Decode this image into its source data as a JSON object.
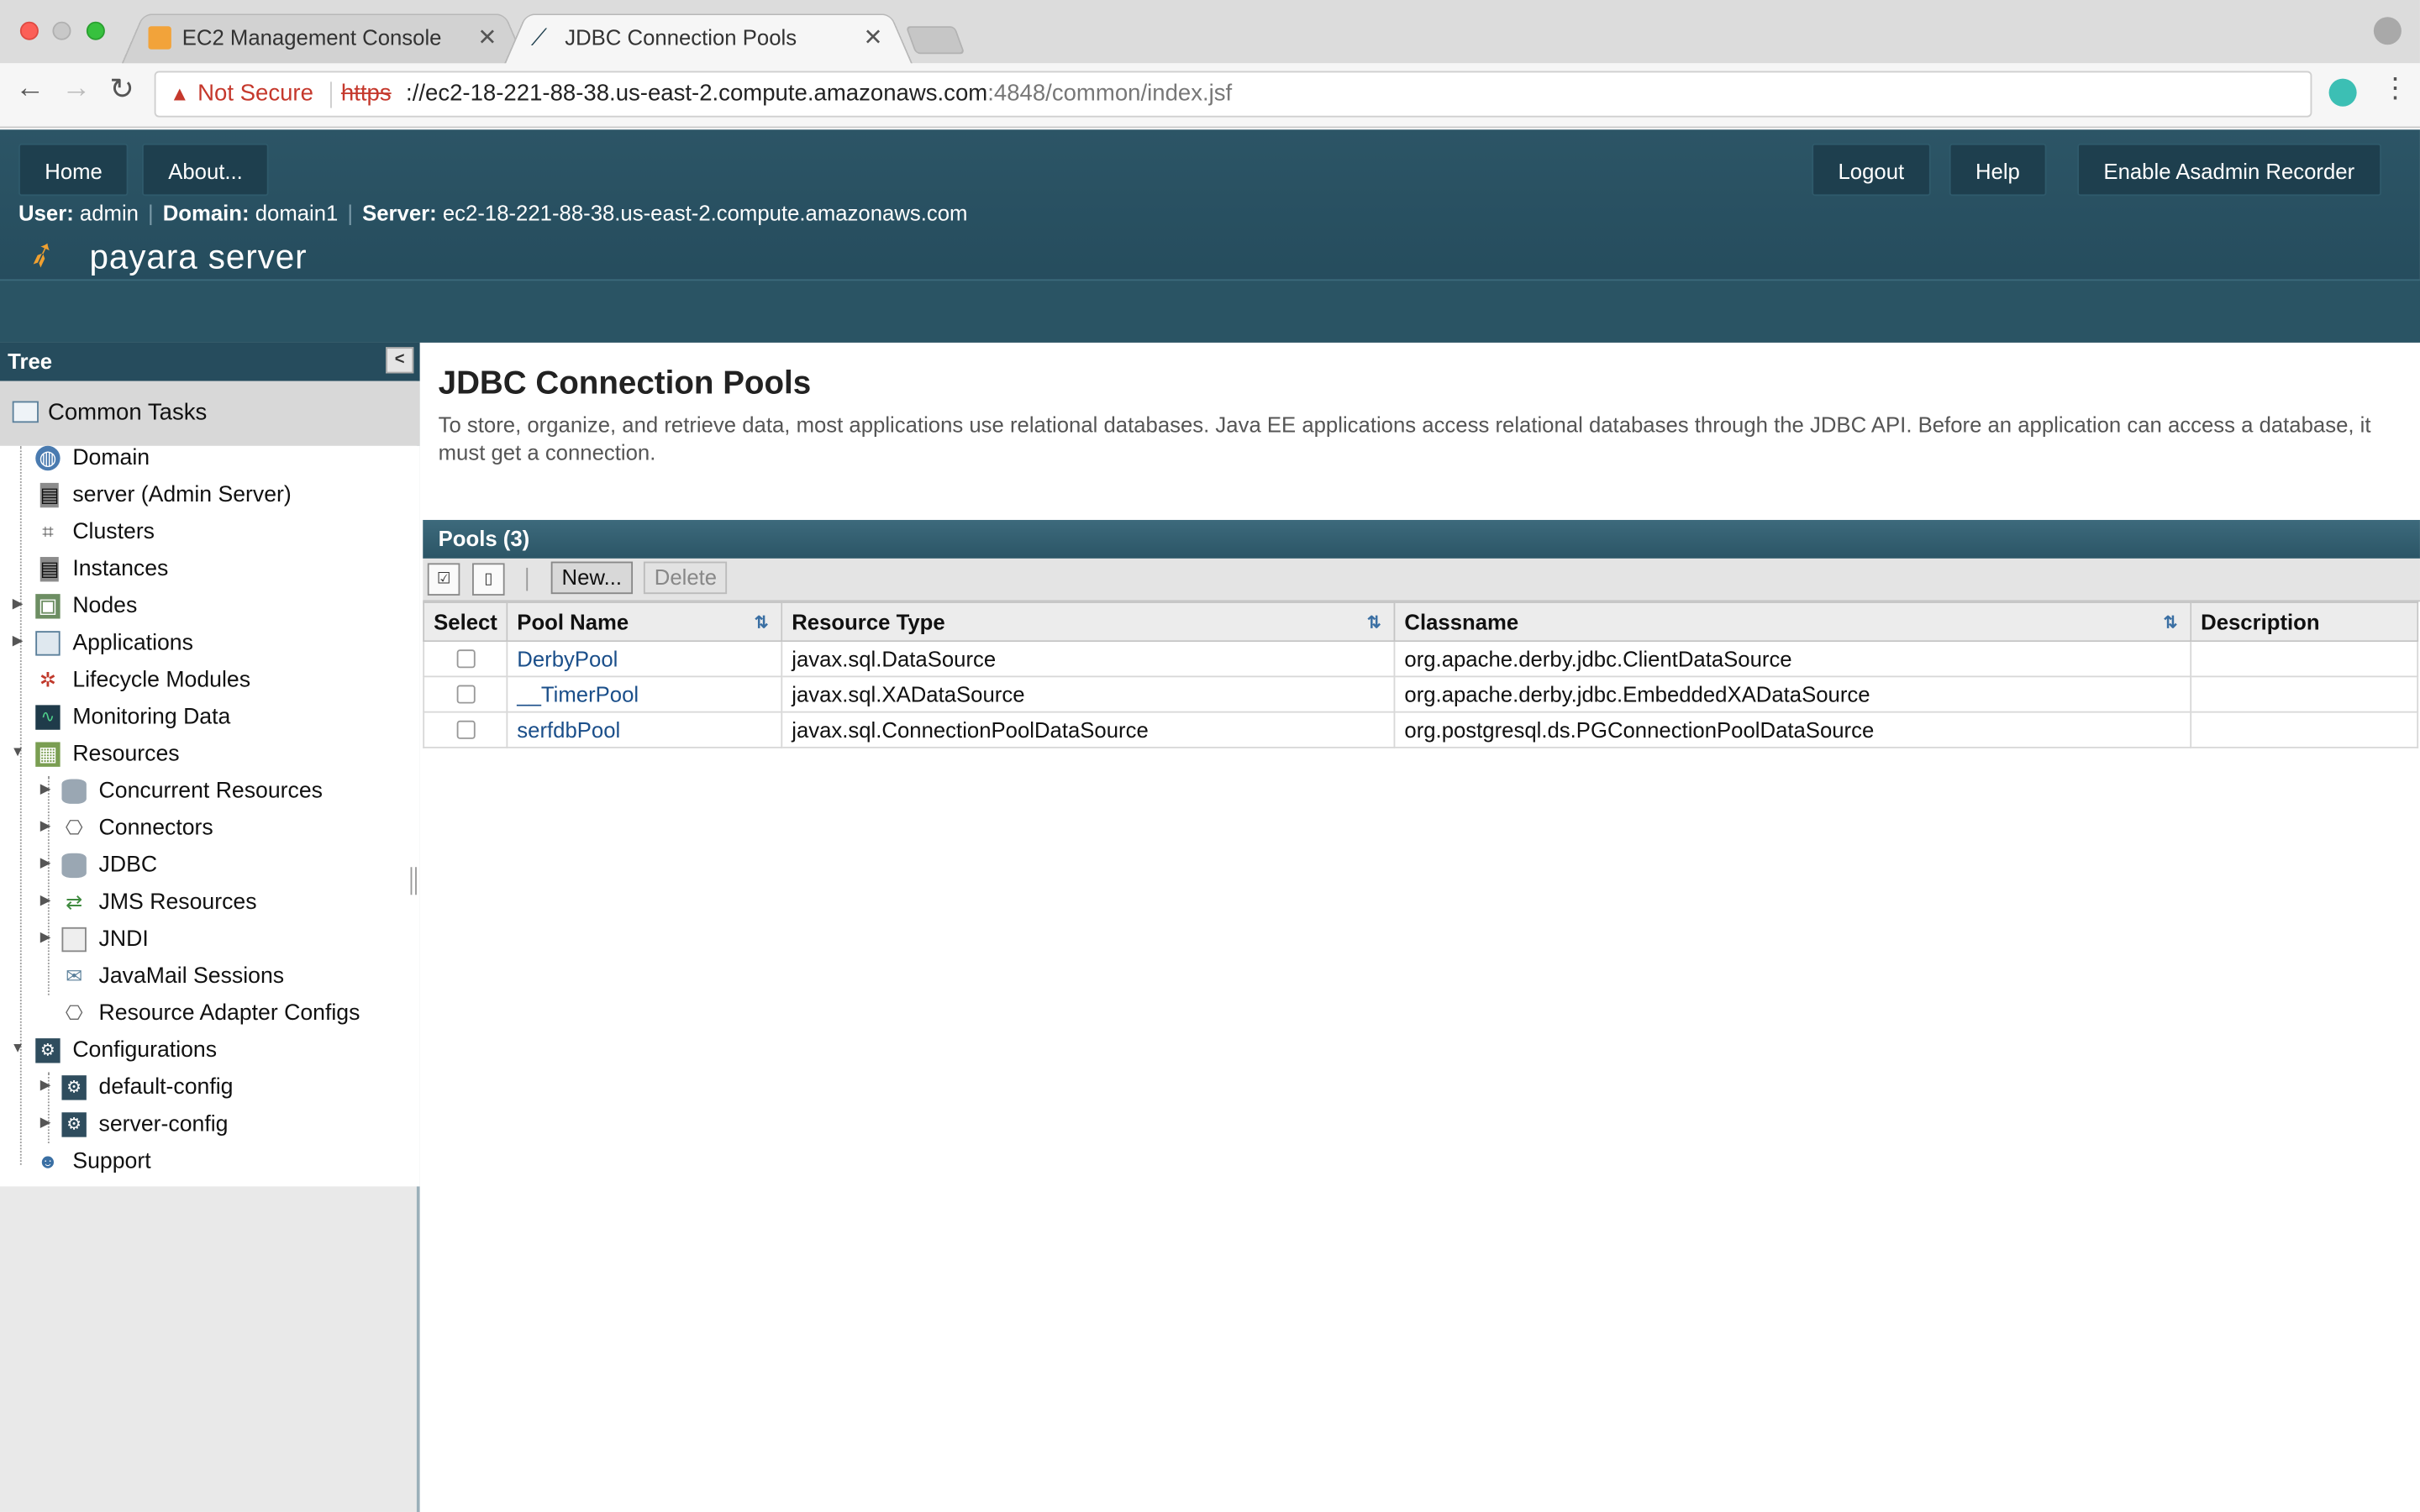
{
  "browser": {
    "tabs": [
      {
        "title": "EC2 Management Console"
      },
      {
        "title": "JDBC Connection Pools"
      }
    ],
    "security_label": "Not Secure",
    "url_scheme": "https",
    "url_host": "://ec2-18-221-88-38.us-east-2.compute.amazonaws.com",
    "url_rest": ":4848/common/index.jsf"
  },
  "header": {
    "home": "Home",
    "about": "About...",
    "logout": "Logout",
    "help": "Help",
    "recorder": "Enable Asadmin Recorder",
    "user_label": "User:",
    "user": "admin",
    "domain_label": "Domain:",
    "domain": "domain1",
    "server_label": "Server:",
    "server": "ec2-18-221-88-38.us-east-2.compute.amazonaws.com",
    "logo": "payara server"
  },
  "tree": {
    "title": "Tree",
    "common_tasks": "Common Tasks",
    "items": [
      {
        "label": "Domain"
      },
      {
        "label": "server (Admin Server)"
      },
      {
        "label": "Clusters"
      },
      {
        "label": "Instances"
      },
      {
        "label": "Nodes"
      },
      {
        "label": "Applications"
      },
      {
        "label": "Lifecycle Modules"
      },
      {
        "label": "Monitoring Data"
      },
      {
        "label": "Resources"
      },
      {
        "label": "Concurrent Resources"
      },
      {
        "label": "Connectors"
      },
      {
        "label": "JDBC"
      },
      {
        "label": "JMS Resources"
      },
      {
        "label": "JNDI"
      },
      {
        "label": "JavaMail Sessions"
      },
      {
        "label": "Resource Adapter Configs"
      },
      {
        "label": "Configurations"
      },
      {
        "label": "default-config"
      },
      {
        "label": "server-config"
      },
      {
        "label": "Support"
      }
    ]
  },
  "main": {
    "title": "JDBC Connection Pools",
    "description": "To store, organize, and retrieve data, most applications use relational databases. Java EE applications access relational databases through the JDBC API. Before an application can access a database, it must get a connection.",
    "pools_header": "Pools (3)",
    "new_button": "New...",
    "delete_button": "Delete",
    "columns": [
      "Select",
      "Pool Name",
      "Resource Type",
      "Classname",
      "Description"
    ],
    "rows": [
      {
        "name": "DerbyPool",
        "type": "javax.sql.DataSource",
        "classname": "org.apache.derby.jdbc.ClientDataSource",
        "description": ""
      },
      {
        "name": "__TimerPool",
        "type": "javax.sql.XADataSource",
        "classname": "org.apache.derby.jdbc.EmbeddedXADataSource",
        "description": ""
      },
      {
        "name": "serfdbPool",
        "type": "javax.sql.ConnectionPoolDataSource",
        "classname": "org.postgresql.ds.PGConnectionPoolDataSource",
        "description": ""
      }
    ]
  }
}
